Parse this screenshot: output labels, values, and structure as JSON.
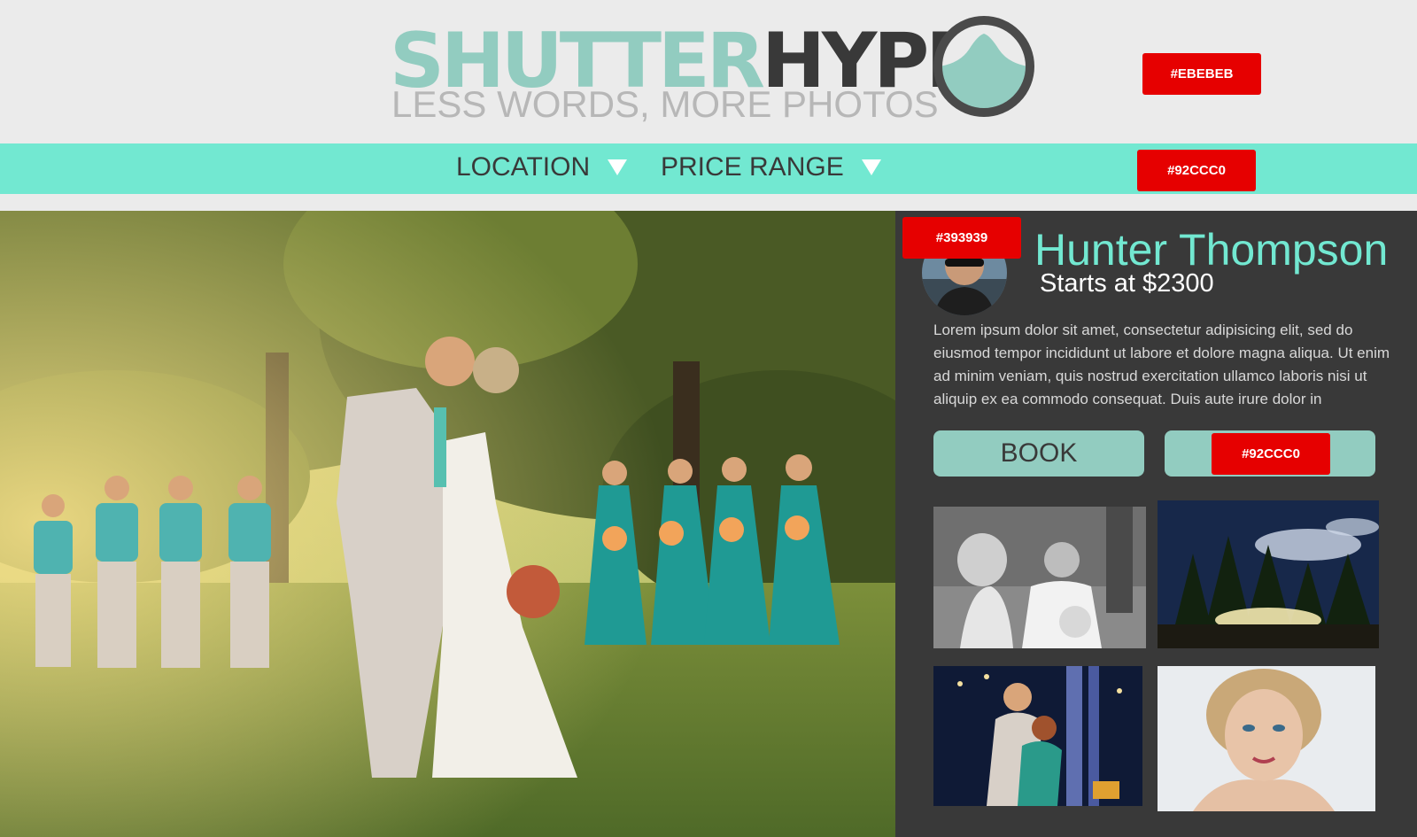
{
  "header": {
    "logo_part1": "SHUTTER",
    "logo_part2": "HYPE",
    "tagline": "LESS WORDS, MORE PHOTOS",
    "color_tag": "#EBEBEB"
  },
  "nav": {
    "items": [
      {
        "label": "LOCATION"
      },
      {
        "label": "PRICE RANGE"
      }
    ],
    "color_tag": "#92CCC0"
  },
  "panel": {
    "color_tag": "#393939",
    "photographer_name": "Hunter Thompson",
    "price": "Starts at $2300",
    "description": "Lorem ipsum dolor sit amet, consectetur adipisicing elit, sed do eiusmod tempor incididunt ut labore et dolore magna aliqua. Ut enim ad minim veniam, quis nostrud exercitation ullamco laboris nisi ut aliquip ex ea commodo consequat. Duis aute irure dolor in",
    "book_label": "BOOK",
    "second_button_tag": "#92CCC0"
  },
  "colors": {
    "background": "#EBEBEB",
    "accent": "#92CCC0",
    "nav": "#72E8D1",
    "panel": "#393939",
    "tag": "#E60000"
  }
}
